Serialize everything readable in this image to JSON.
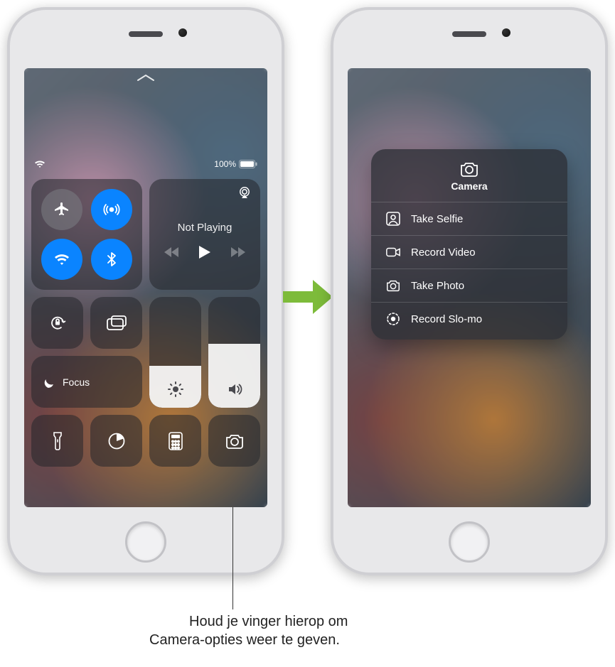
{
  "status": {
    "battery_text": "100%"
  },
  "media": {
    "title": "Not Playing"
  },
  "focus": {
    "label": "Focus"
  },
  "brightness": {
    "level_pct": 38
  },
  "volume": {
    "level_pct": 58
  },
  "camera_menu": {
    "title": "Camera",
    "items": [
      {
        "label": "Take Selfie"
      },
      {
        "label": "Record Video"
      },
      {
        "label": "Take Photo"
      },
      {
        "label": "Record Slo-mo"
      }
    ]
  },
  "caption": {
    "line1": "Houd je vinger hierop om",
    "line2": "Camera-opties weer te geven."
  }
}
